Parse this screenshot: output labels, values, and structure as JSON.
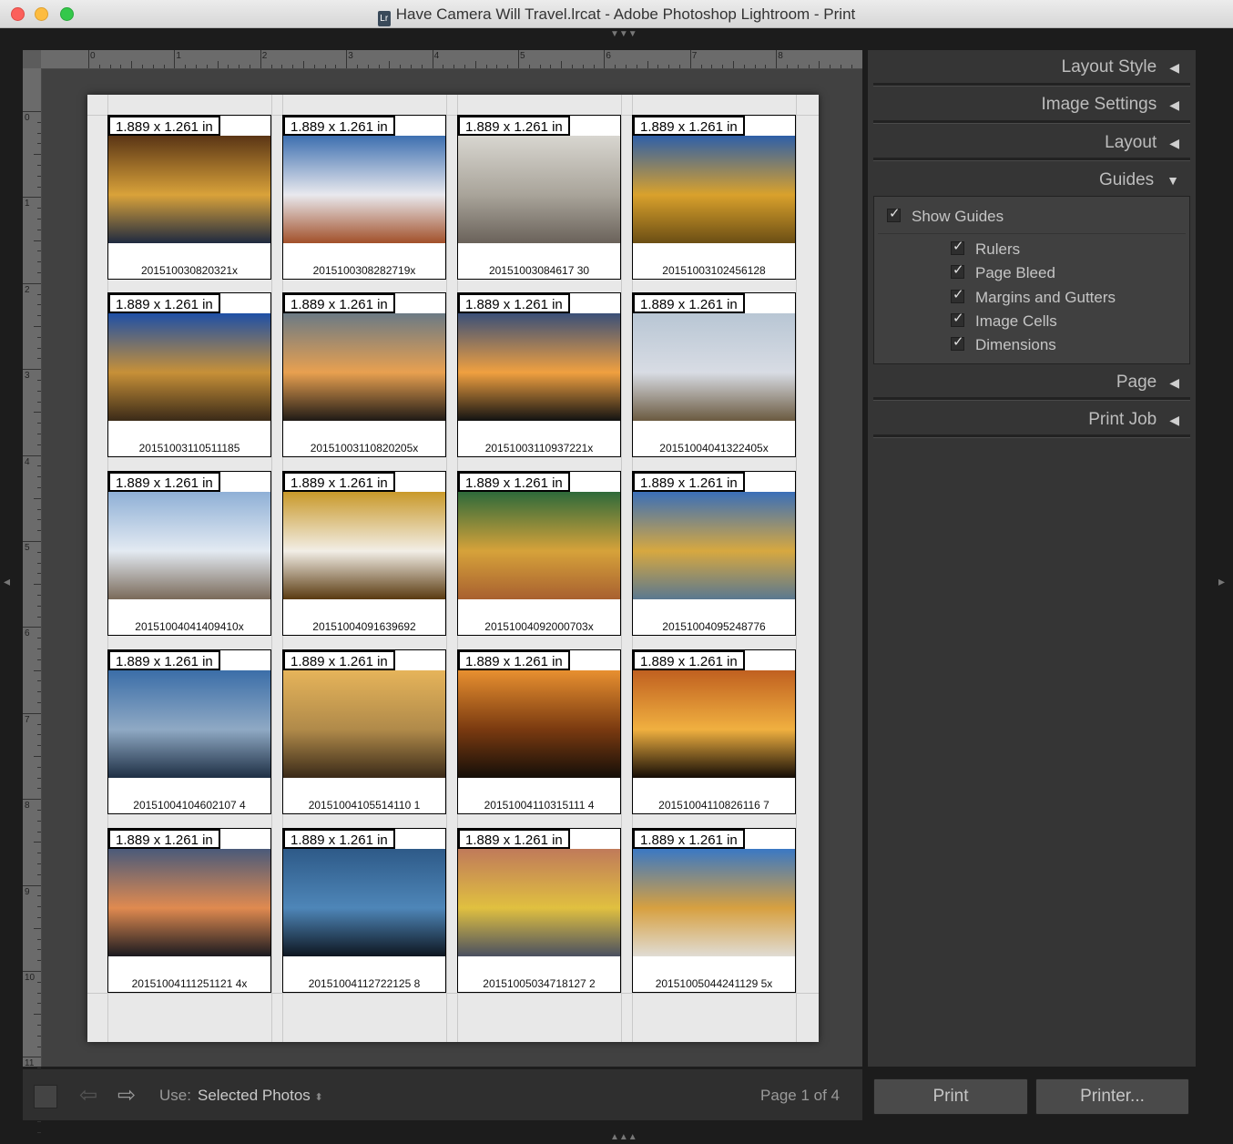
{
  "window": {
    "title": "Have Camera Will Travel.lrcat - Adobe Photoshop Lightroom - Print",
    "doc_icon": "Lr"
  },
  "ruler": {
    "top": [
      "0",
      "1",
      "2",
      "3",
      "4",
      "5",
      "6",
      "7",
      "8"
    ],
    "left": [
      "0",
      "1",
      "2",
      "3",
      "4",
      "5",
      "6",
      "7",
      "8",
      "9",
      "10",
      "11"
    ]
  },
  "cells": [
    {
      "dim": "1.889 x 1.261 in",
      "name": "201510030820321x",
      "colors": [
        "#5a3515",
        "#d9a23a",
        "#1f2a40"
      ]
    },
    {
      "dim": "1.889 x 1.261 in",
      "name": "2015100308282719x",
      "colors": [
        "#3d6fb0",
        "#e9e9ee",
        "#a2502a"
      ]
    },
    {
      "dim": "1.889 x 1.261 in",
      "name": "20151003084617 30",
      "colors": [
        "#d8d6d0",
        "#a9a49a",
        "#6a625a"
      ]
    },
    {
      "dim": "1.889 x 1.261 in",
      "name": "20151003102456128",
      "colors": [
        "#2e5fa8",
        "#d9a12c",
        "#6b4e14"
      ]
    },
    {
      "dim": "1.889 x 1.261 in",
      "name": "20151003110511185",
      "colors": [
        "#1e4fa6",
        "#c79038",
        "#3a2a18"
      ]
    },
    {
      "dim": "1.889 x 1.261 in",
      "name": "20151003110820205x",
      "colors": [
        "#6b7a85",
        "#e8a050",
        "#1f1a16"
      ]
    },
    {
      "dim": "1.889 x 1.261 in",
      "name": "20151003110937221x",
      "colors": [
        "#3a4f78",
        "#f0a040",
        "#121212"
      ]
    },
    {
      "dim": "1.889 x 1.261 in",
      "name": "20151004041322405x",
      "colors": [
        "#b8c6d4",
        "#d8dce4",
        "#6b5a40"
      ]
    },
    {
      "dim": "1.889 x 1.261 in",
      "name": "20151004041409410x",
      "colors": [
        "#8fb0d6",
        "#e3eaf2",
        "#7a6a5a"
      ]
    },
    {
      "dim": "1.889 x 1.261 in",
      "name": "20151004091639692",
      "colors": [
        "#c9992a",
        "#f2eee6",
        "#5a3a10"
      ]
    },
    {
      "dim": "1.889 x 1.261 in",
      "name": "20151004092000703x",
      "colors": [
        "#2e6a3a",
        "#d6a23a",
        "#a86030"
      ]
    },
    {
      "dim": "1.889 x 1.261 in",
      "name": "20151004095248776",
      "colors": [
        "#3a6fb8",
        "#d7a840",
        "#5a7890"
      ]
    },
    {
      "dim": "1.889 x 1.261 in",
      "name": "20151004104602107 4",
      "colors": [
        "#3b6ea8",
        "#8fa9c4",
        "#1e2f44"
      ]
    },
    {
      "dim": "1.889 x 1.261 in",
      "name": "20151004105514110 1",
      "colors": [
        "#e6b45a",
        "#b08a4a",
        "#3a2a18"
      ]
    },
    {
      "dim": "1.889 x 1.261 in",
      "name": "20151004110315111 4",
      "colors": [
        "#e89030",
        "#7a3a10",
        "#140e08"
      ]
    },
    {
      "dim": "1.889 x 1.261 in",
      "name": "20151004110826116 7",
      "colors": [
        "#c06020",
        "#f0b040",
        "#140c06"
      ]
    },
    {
      "dim": "1.889 x 1.261 in",
      "name": "20151004111251121 4x",
      "colors": [
        "#4a5a7a",
        "#e08a50",
        "#1a1a20"
      ]
    },
    {
      "dim": "1.889 x 1.261 in",
      "name": "20151004112722125 8",
      "colors": [
        "#2e5a88",
        "#4e86b8",
        "#0e1620"
      ]
    },
    {
      "dim": "1.889 x 1.261 in",
      "name": "20151005034718127 2",
      "colors": [
        "#c07a5a",
        "#e0c040",
        "#4a5060"
      ]
    },
    {
      "dim": "1.889 x 1.261 in",
      "name": "20151005044241129 5x",
      "colors": [
        "#3a78c4",
        "#d7a040",
        "#e0dcd4"
      ]
    }
  ],
  "panel": {
    "sections": [
      "Layout Style",
      "Image Settings",
      "Layout",
      "Guides",
      "Page",
      "Print Job"
    ],
    "show_guides": "Show Guides",
    "guide_options": [
      "Rulers",
      "Page Bleed",
      "Margins and Gutters",
      "Image Cells",
      "Dimensions"
    ],
    "print_button": "Print",
    "printer_button": "Printer..."
  },
  "bottom": {
    "use_label": "Use:",
    "use_value": "Selected Photos",
    "page_count": "Page 1 of 4"
  }
}
